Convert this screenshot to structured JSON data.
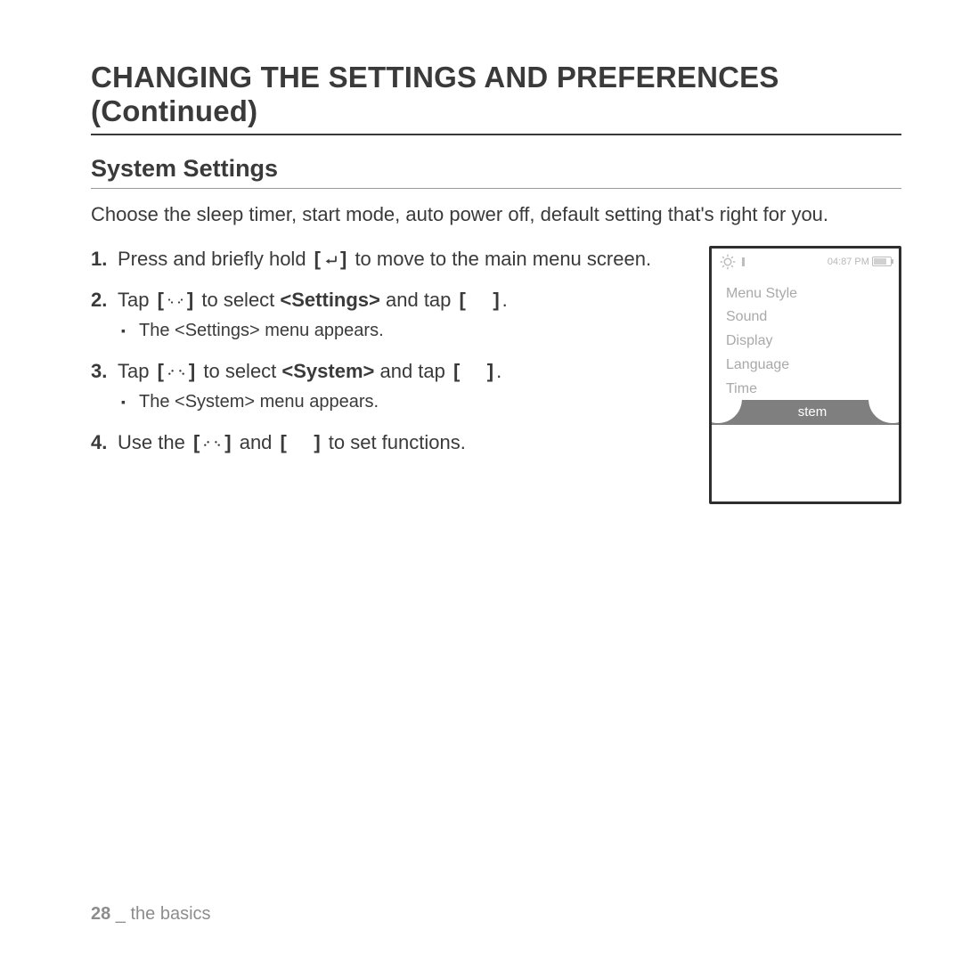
{
  "heading": "CHANGING THE SETTINGS AND PREFERENCES (Continued)",
  "subheading": "System Settings",
  "intro": "Choose the sleep timer, start mode, auto power off, default setting that's right for you.",
  "steps": {
    "s1": {
      "a": "Press and briefly hold ",
      "b": " to move to the main menu screen."
    },
    "s2": {
      "a": "Tap ",
      "b": " to select ",
      "bold": "<Settings>",
      "c": " and tap ",
      "note": "The <Settings> menu appears."
    },
    "s3": {
      "a": "Tap ",
      "b": " to select ",
      "bold": "<System>",
      "c": " and tap ",
      "note": "The <System> menu appears."
    },
    "s4": {
      "a": "Use the ",
      "b": " and ",
      "c": " to set functions."
    }
  },
  "device": {
    "time": "04:87 PM",
    "items": [
      "Menu Style",
      "Sound",
      "Display",
      "Language",
      "Time"
    ],
    "selected_fragment": "stem"
  },
  "footer": {
    "page": "28",
    "sep": " _ ",
    "section": "the basics"
  },
  "brackets": {
    "open": "[",
    "close": "]"
  },
  "punct": {
    "period": "."
  }
}
